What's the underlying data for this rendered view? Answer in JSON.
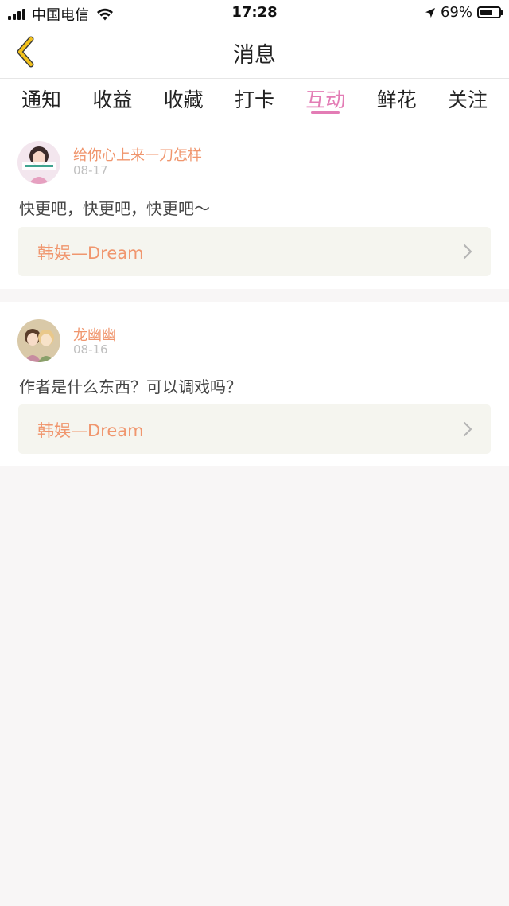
{
  "status_bar": {
    "carrier": "中国电信",
    "time": "17:28",
    "battery": "69%",
    "battery_level": 0.69
  },
  "nav": {
    "title": "消息",
    "back_icon": "chevron-left-icon"
  },
  "tabs": [
    {
      "label": "通知",
      "active": false
    },
    {
      "label": "收益",
      "active": false
    },
    {
      "label": "收藏",
      "active": false
    },
    {
      "label": "打卡",
      "active": false
    },
    {
      "label": "互动",
      "active": true
    },
    {
      "label": "鲜花",
      "active": false
    },
    {
      "label": "关注",
      "active": false
    }
  ],
  "messages": [
    {
      "username": "给你心上来一刀怎样",
      "date": "08-17",
      "text": "快更吧，快更吧，快更吧～",
      "link_label": "韩娱—Dream"
    },
    {
      "username": "龙幽幽",
      "date": "08-16",
      "text": "作者是什么东西？可以调戏吗？",
      "link_label": "韩娱—Dream"
    }
  ],
  "colors": {
    "accent_pink": "#e37cb5",
    "username_orange": "#f0966e",
    "back_icon_yellow": "#f2c11c"
  }
}
